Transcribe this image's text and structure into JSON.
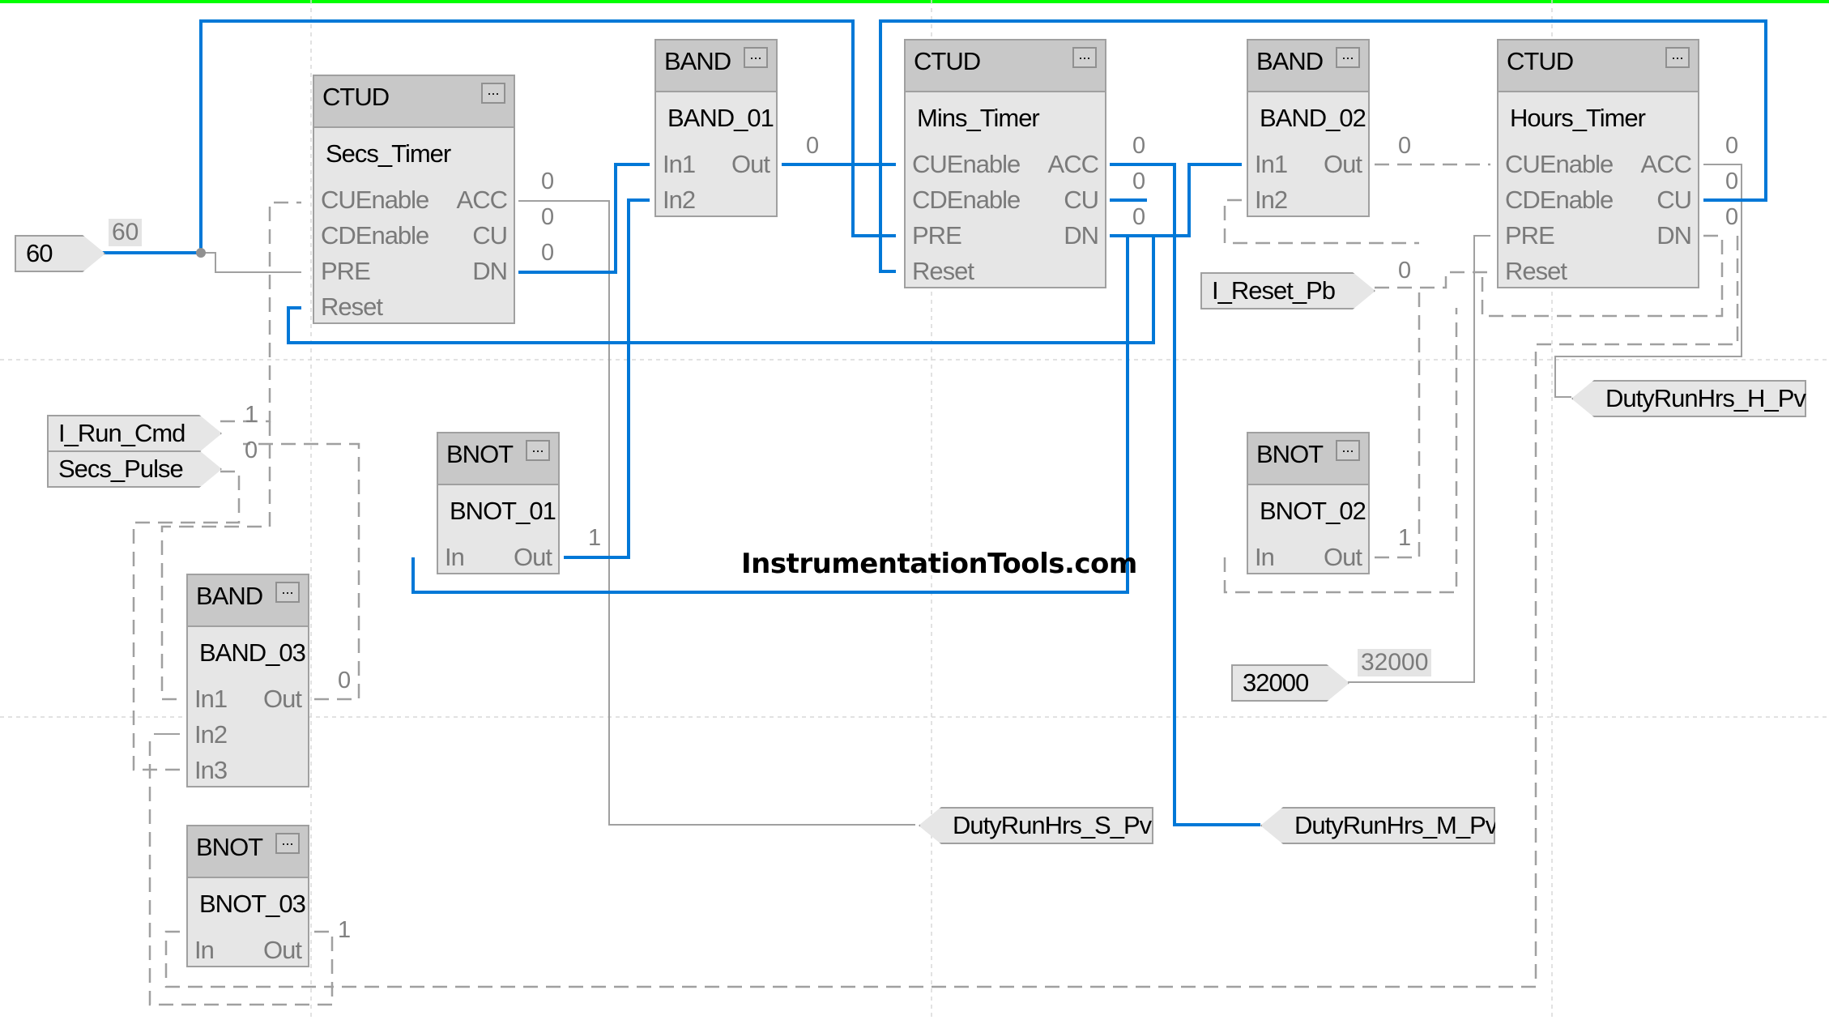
{
  "watermark": "InstrumentationTools.com",
  "colors": {
    "active_wire": "#0078d7",
    "inactive_wire": "#a0a0a0",
    "top_bar": "#00ff00"
  },
  "blocks": {
    "secs_timer": {
      "type": "CTUD",
      "tag": "Secs_Timer",
      "more": "...",
      "inputs": [
        "CUEnable",
        "CDEnable",
        "PRE",
        "Reset"
      ],
      "outputs": [
        "ACC",
        "CU",
        "DN"
      ],
      "output_values": [
        "0",
        "0",
        "0"
      ]
    },
    "band_01": {
      "type": "BAND",
      "tag": "BAND_01",
      "more": "...",
      "inputs": [
        "In1",
        "In2"
      ],
      "outputs": [
        "Out"
      ],
      "output_values": [
        "0"
      ]
    },
    "mins_timer": {
      "type": "CTUD",
      "tag": "Mins_Timer",
      "more": "...",
      "inputs": [
        "CUEnable",
        "CDEnable",
        "PRE",
        "Reset"
      ],
      "outputs": [
        "ACC",
        "CU",
        "DN"
      ],
      "output_values": [
        "0",
        "0",
        "0"
      ]
    },
    "band_02": {
      "type": "BAND",
      "tag": "BAND_02",
      "more": "...",
      "inputs": [
        "In1",
        "In2"
      ],
      "outputs": [
        "Out"
      ],
      "output_values": [
        "0"
      ]
    },
    "hours_timer": {
      "type": "CTUD",
      "tag": "Hours_Timer",
      "more": "...",
      "inputs": [
        "CUEnable",
        "CDEnable",
        "PRE",
        "Reset"
      ],
      "outputs": [
        "ACC",
        "CU",
        "DN"
      ],
      "output_values": [
        "0",
        "0",
        "0"
      ]
    },
    "bnot_01": {
      "type": "BNOT",
      "tag": "BNOT_01",
      "more": "...",
      "inputs": [
        "In"
      ],
      "outputs": [
        "Out"
      ],
      "output_values": [
        "1"
      ]
    },
    "bnot_02": {
      "type": "BNOT",
      "tag": "BNOT_02",
      "more": "...",
      "inputs": [
        "In"
      ],
      "outputs": [
        "Out"
      ],
      "output_values": [
        "1"
      ]
    },
    "band_03": {
      "type": "BAND",
      "tag": "BAND_03",
      "more": "...",
      "inputs": [
        "In1",
        "In2",
        "In3"
      ],
      "outputs": [
        "Out"
      ],
      "output_values": [
        "0"
      ]
    },
    "bnot_03": {
      "type": "BNOT",
      "tag": "BNOT_03",
      "more": "...",
      "inputs": [
        "In"
      ],
      "outputs": [
        "Out"
      ],
      "output_values": [
        "1"
      ]
    }
  },
  "input_refs": {
    "const_60": {
      "label": "60",
      "value": "60"
    },
    "i_run_cmd": {
      "label": "I_Run_Cmd",
      "value": "1"
    },
    "secs_pulse": {
      "label": "Secs_Pulse",
      "value": "0"
    },
    "i_reset_pb": {
      "label": "I_Reset_Pb",
      "value": "0"
    },
    "const_32000": {
      "label": "32000",
      "value": "32000"
    }
  },
  "output_refs": {
    "duty_s": {
      "label": "DutyRunHrs_S_Pv"
    },
    "duty_m": {
      "label": "DutyRunHrs_M_Pv"
    },
    "duty_h": {
      "label": "DutyRunHrs_H_Pv"
    }
  }
}
